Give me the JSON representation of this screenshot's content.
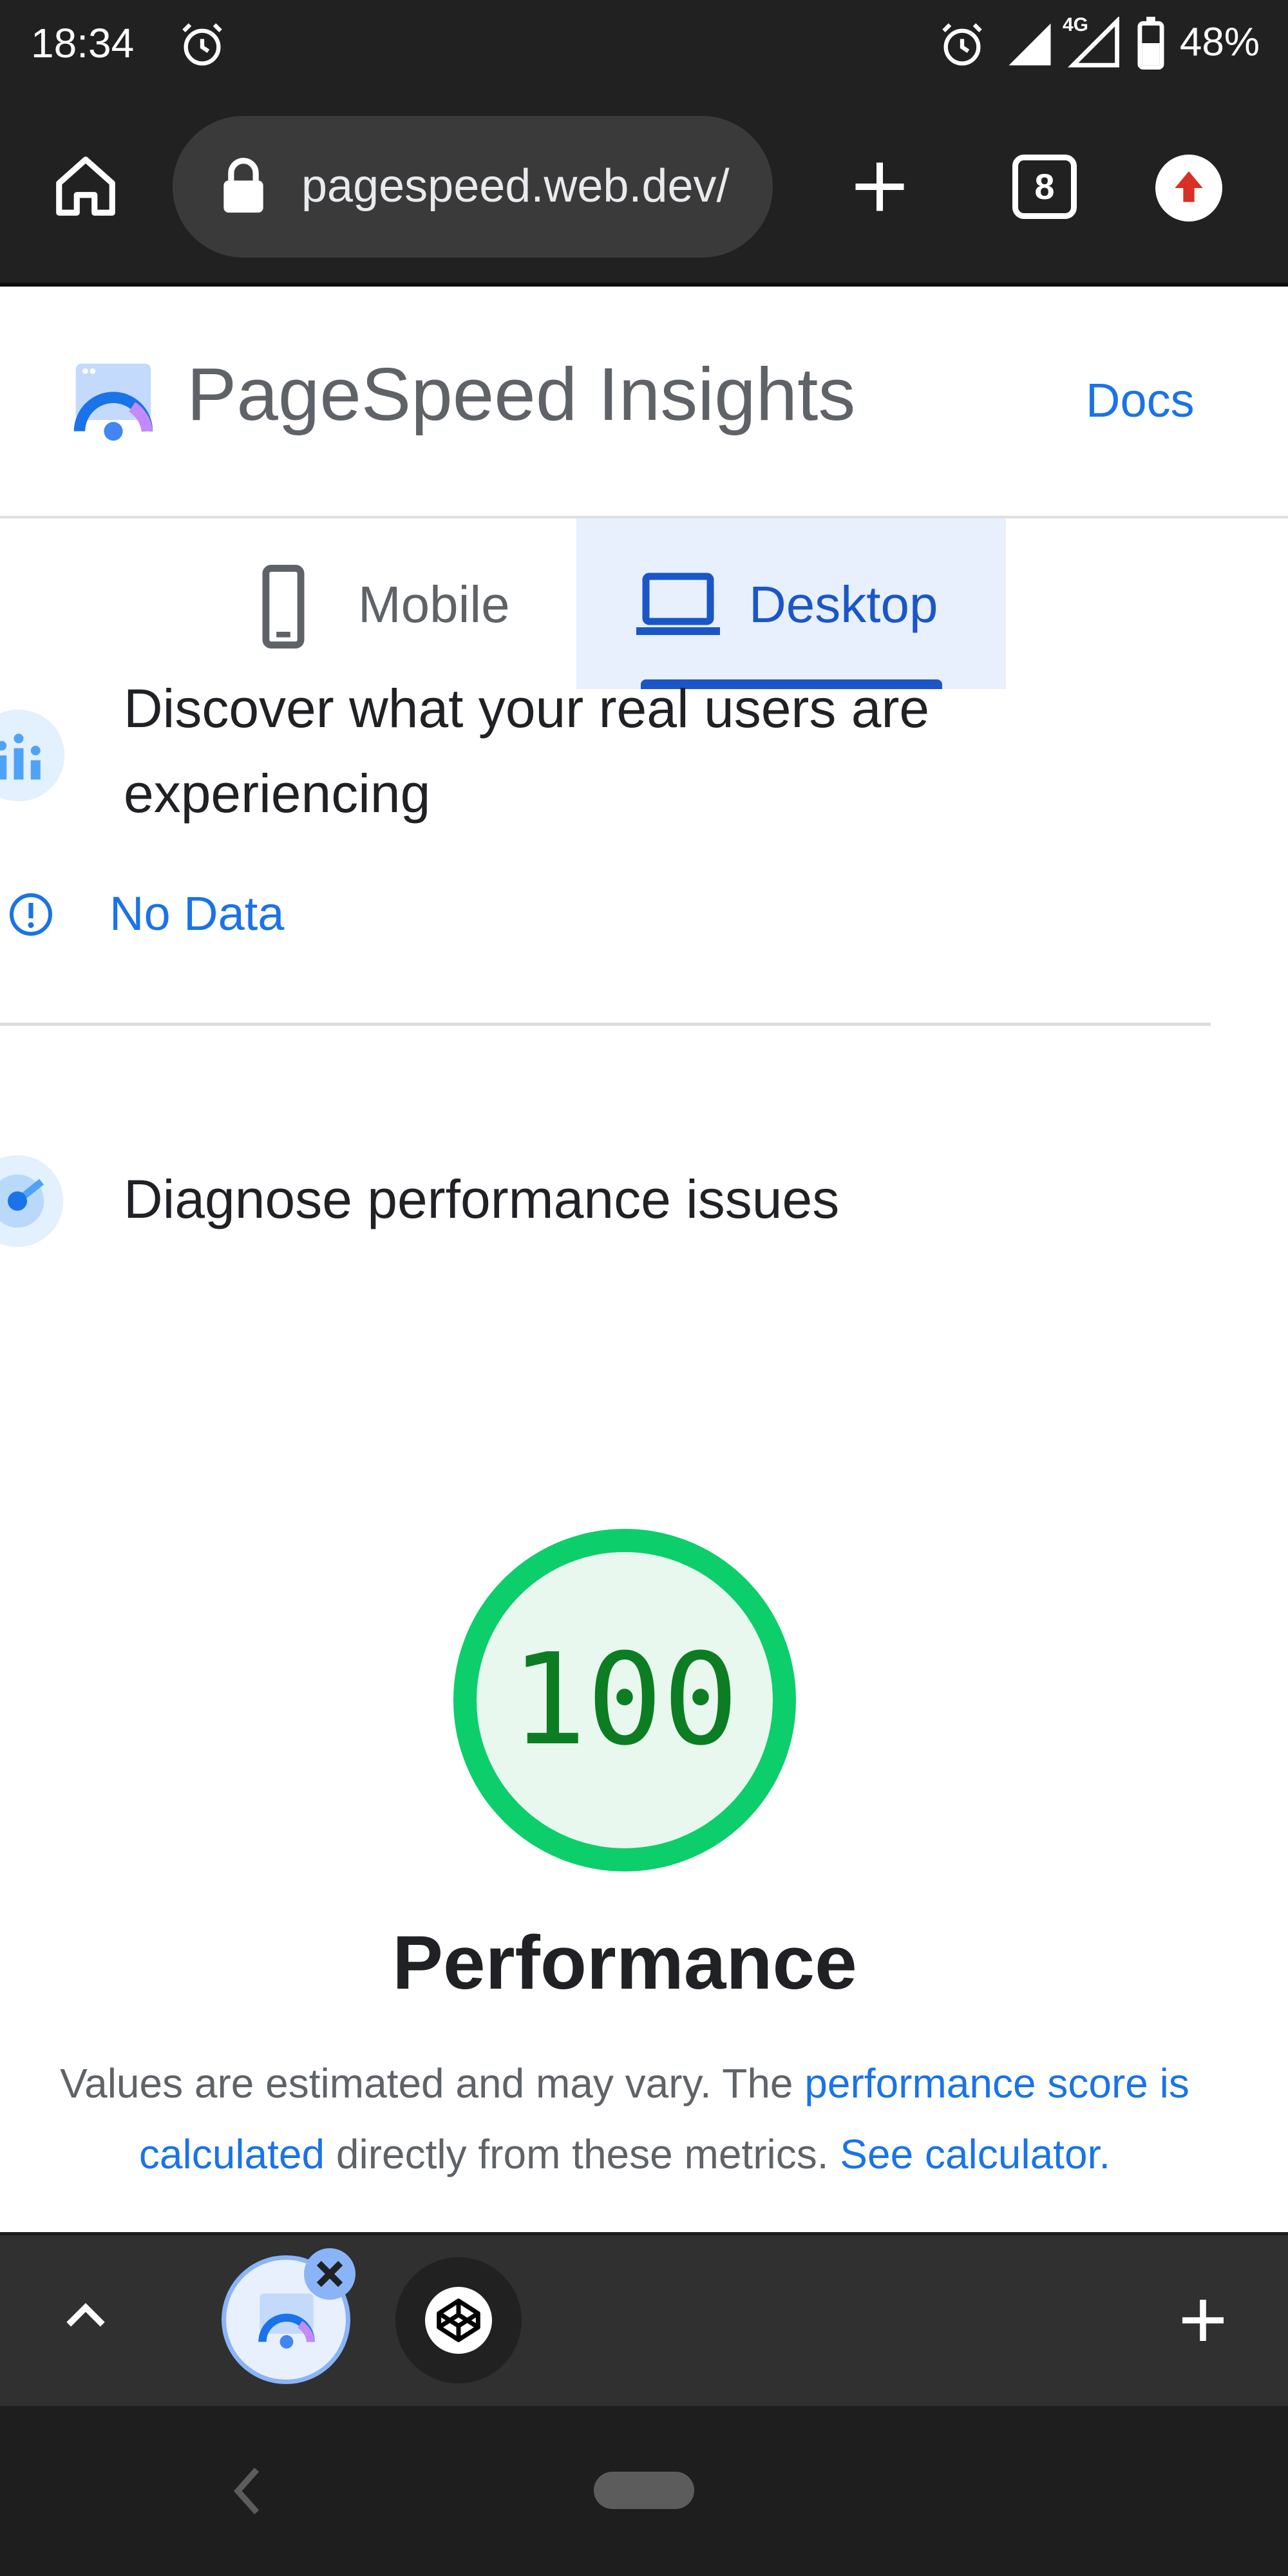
{
  "status_bar": {
    "time": "18:34",
    "network": "4G",
    "battery": "48%"
  },
  "browser": {
    "url": "pagespeed.web.dev/",
    "tab_count": "8",
    "icons": [
      "home-icon",
      "lock-icon",
      "new-tab-icon",
      "tab-switcher-icon",
      "update-icon"
    ]
  },
  "header": {
    "title": "PageSpeed Insights",
    "docs_link": "Docs"
  },
  "device_tabs": {
    "mobile": "Mobile",
    "desktop": "Desktop",
    "selected": "Desktop"
  },
  "field_data": {
    "title": "Discover what your real users are experiencing",
    "status": "No Data"
  },
  "lab_data": {
    "title": "Diagnose performance issues"
  },
  "performance": {
    "score": "100",
    "score_fraction": 1.0,
    "label": "Performance",
    "desc_part1": "Values are estimated and may vary. The ",
    "desc_link1": "performance score is calculated",
    "desc_part2": " directly from these metrics. ",
    "desc_link2": "See calculator."
  },
  "colors": {
    "accent": "#1a73e8",
    "score_good": "#0cce6b",
    "score_text": "#0c7d22"
  }
}
